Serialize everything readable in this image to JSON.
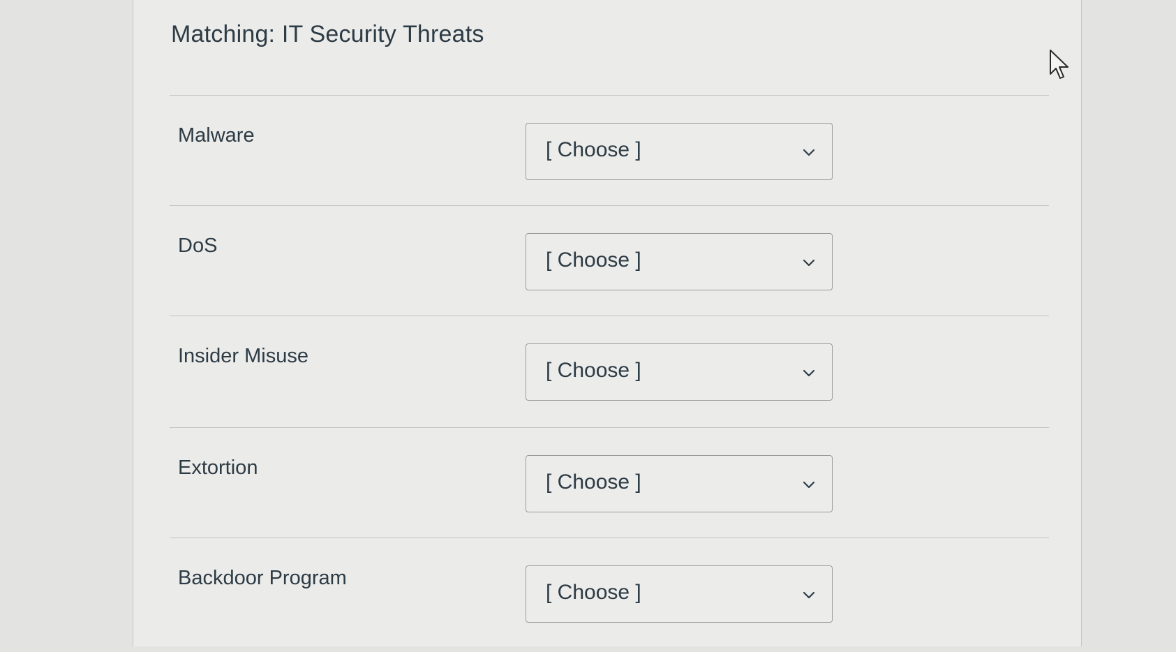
{
  "page": {
    "title": "Matching: IT Security Threats"
  },
  "items": [
    {
      "label": "Malware",
      "value": "[ Choose ]"
    },
    {
      "label": "DoS",
      "value": "[ Choose ]"
    },
    {
      "label": "Insider Misuse",
      "value": "[ Choose ]"
    },
    {
      "label": "Extortion",
      "value": "[ Choose ]"
    },
    {
      "label": "Backdoor Program",
      "value": "[ Choose ]"
    }
  ],
  "icons": {
    "dropdown": "chevron-down-icon",
    "cursor": "mouse-pointer-icon"
  }
}
